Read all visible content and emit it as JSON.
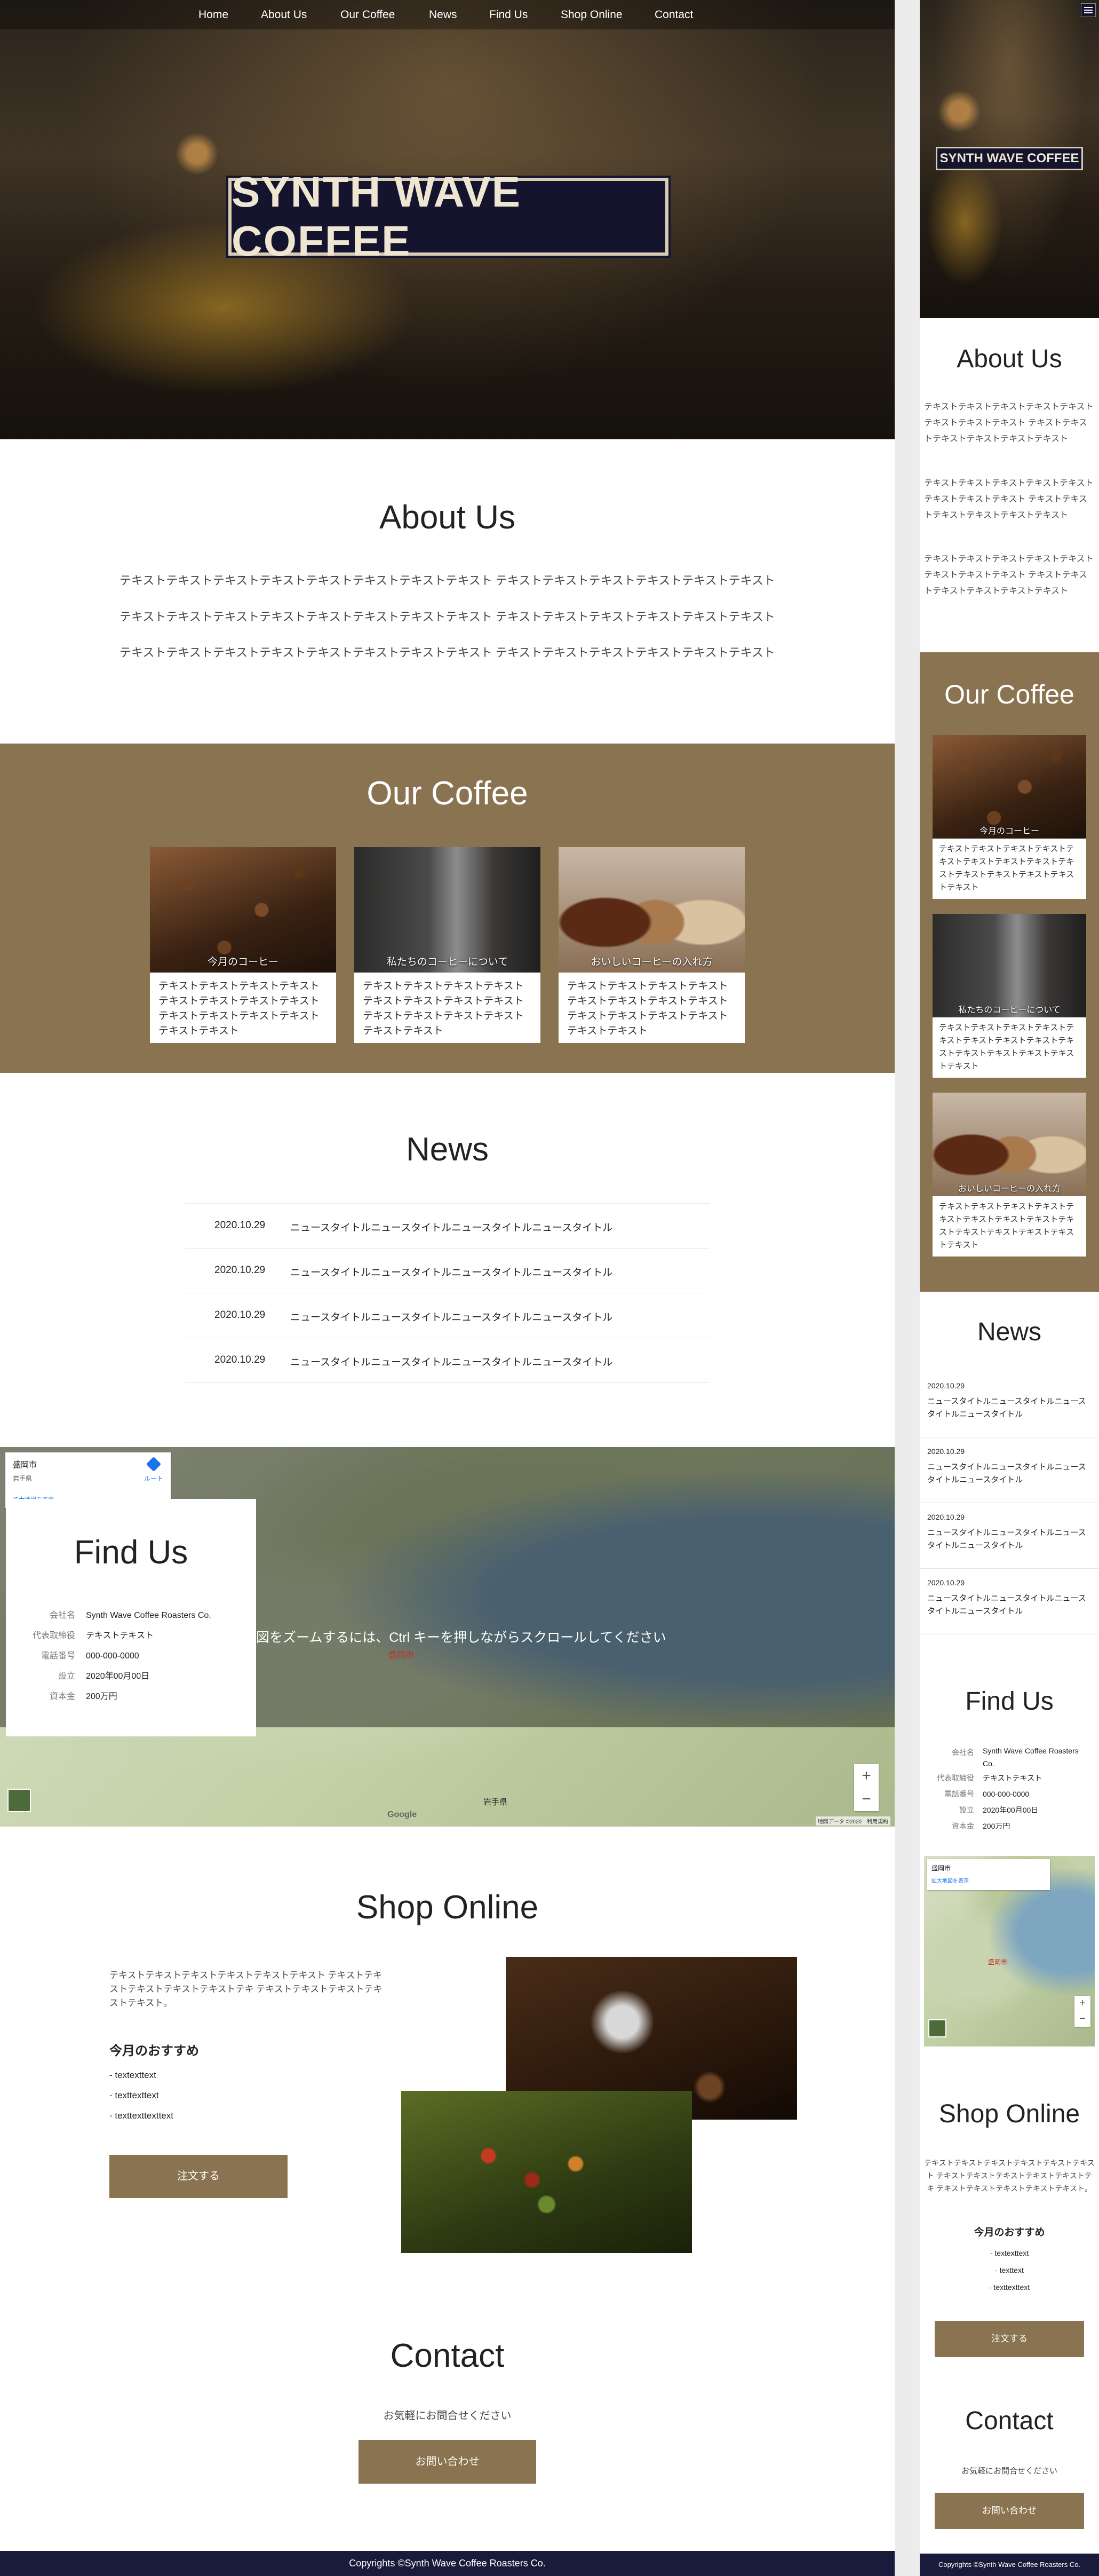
{
  "nav": {
    "items": [
      "Home",
      "About Us",
      "Our Coffee",
      "News",
      "Find Us",
      "Shop Online",
      "Contact"
    ]
  },
  "hero": {
    "title": "SYNTH WAVE COFFEE"
  },
  "about": {
    "title": "About Us",
    "paragraphs": [
      "テキストテキストテキストテキストテキストテキストテキストテキスト テキストテキストテキストテキストテキストテキスト",
      "テキストテキストテキストテキストテキストテキストテキストテキスト テキストテキストテキストテキストテキストテキスト",
      "テキストテキストテキストテキストテキストテキストテキストテキスト テキストテキストテキストテキストテキストテキスト"
    ]
  },
  "coffee": {
    "title": "Our Coffee",
    "cards": [
      {
        "caption": "今月のコーヒー",
        "text": "テキストテキストテキストテキストテキストテキストテキストテキストテキストテキストテキストテキストテキストテキスト"
      },
      {
        "caption": "私たちのコーヒーについて",
        "text": "テキストテキストテキストテキストテキストテキストテキストテキストテキストテキストテキストテキストテキストテキスト"
      },
      {
        "caption": "おいしいコーヒーの入れ方",
        "text": "テキストテキストテキストテキストテキストテキストテキストテキストテキストテキストテキストテキストテキストテキスト"
      }
    ]
  },
  "news": {
    "title": "News",
    "items": [
      {
        "date": "2020.10.29",
        "title": "ニュースタイトルニュースタイトルニュースタイトルニュースタイトル"
      },
      {
        "date": "2020.10.29",
        "title": "ニュースタイトルニュースタイトルニュースタイトルニュースタイトル"
      },
      {
        "date": "2020.10.29",
        "title": "ニュースタイトルニュースタイトルニュースタイトルニュースタイトル"
      },
      {
        "date": "2020.10.29",
        "title": "ニュースタイトルニュースタイトルニュースタイトルニュースタイトル"
      }
    ]
  },
  "findus": {
    "title": "Find Us",
    "rows": [
      {
        "label": "会社名",
        "value": "Synth Wave Coffee Roasters Co."
      },
      {
        "label": "代表取締役",
        "value": "テキストテキスト"
      },
      {
        "label": "電話番号",
        "value": "000-000-0000"
      },
      {
        "label": "設立",
        "value": "2020年00月00日"
      },
      {
        "label": "資本金",
        "value": "200万円"
      }
    ],
    "map": {
      "place": "盛岡市",
      "place_sub": "岩手県",
      "link": "拡大地図を表示",
      "route": "ルート",
      "overlay": "地図をズームするには、Ctrl キーを押しながらスクロールしてください",
      "city_label": "盛岡市",
      "region_label": "岩手県",
      "zoom_in": "+",
      "zoom_out": "−",
      "attribution": "地図データ ©2020　利用規約",
      "brand": "Google"
    }
  },
  "shop": {
    "title": "Shop Online",
    "text": "テキストテキストテキストテキストテキストテキスト テキストテキストテキストテキストテキストテキ テキストテキストテキストテキストテキスト。",
    "recommend_title": "今月のおすすめ",
    "items": [
      "- textexttext",
      "- texttexttext",
      "- texttexttexttext"
    ],
    "button": "注文する"
  },
  "contact": {
    "title": "Contact",
    "text": "お気軽にお問合せください",
    "button": "お問い合わせ"
  },
  "footer": {
    "copyright": "Copyrights ©Synth Wave Coffee Roasters Co."
  },
  "mobile": {
    "about_paragraphs": [
      "テキストテキストテキストテキストテキストテキストテキストテキスト テキストテキストテキストテキストテキストテキスト",
      "テキストテキストテキストテキストテキストテキストテキストテキスト テキストテキストテキストテキストテキストテキスト",
      "テキストテキストテキストテキストテキストテキストテキストテキスト テキストテキストテキストテキストテキストテキスト"
    ],
    "shop_items": [
      "- textexttext",
      "- texttext",
      "- texttexttext"
    ]
  },
  "colors": {
    "accent": "#8a7350",
    "footer": "#1a1a3a",
    "hero_sign": "#14142e"
  }
}
